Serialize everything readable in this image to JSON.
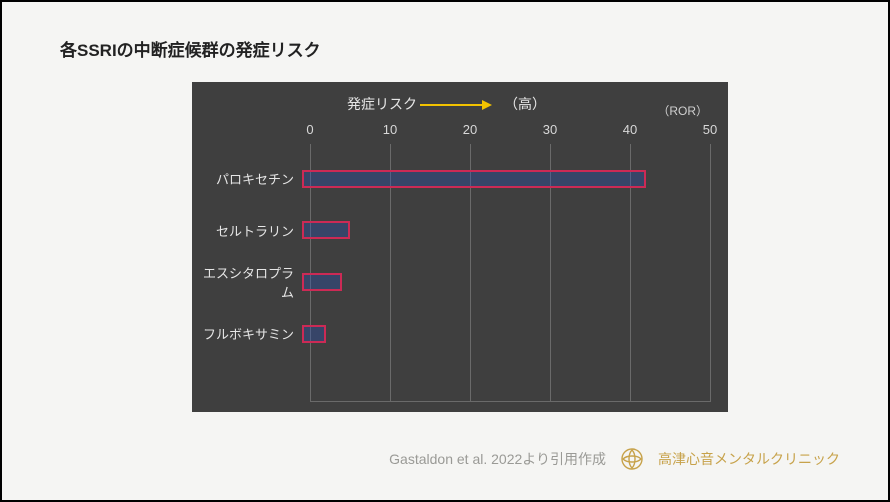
{
  "title": "各SSRIの中断症候群の発症リスク",
  "header": {
    "risk_label": "発症リスク",
    "high_label": "（高）",
    "ror_label": "（ROR）"
  },
  "footer": {
    "source": "Gastaldon et al. 2022より引用作成",
    "clinic": "高津心音メンタルクリニック"
  },
  "chart_data": {
    "type": "bar",
    "orientation": "horizontal",
    "xlabel": "ROR",
    "ylabel": "",
    "xlim": [
      0,
      50
    ],
    "ticks": [
      0,
      10,
      20,
      30,
      40,
      50
    ],
    "categories": [
      "パロキセチン",
      "セルトラリン",
      "エスシタロプラム",
      "フルボキサミン"
    ],
    "values": [
      43,
      6,
      5,
      3
    ],
    "title": "各SSRIの中断症候群の発症リスク",
    "annotations": [
      "発症リスク → （高）"
    ]
  }
}
